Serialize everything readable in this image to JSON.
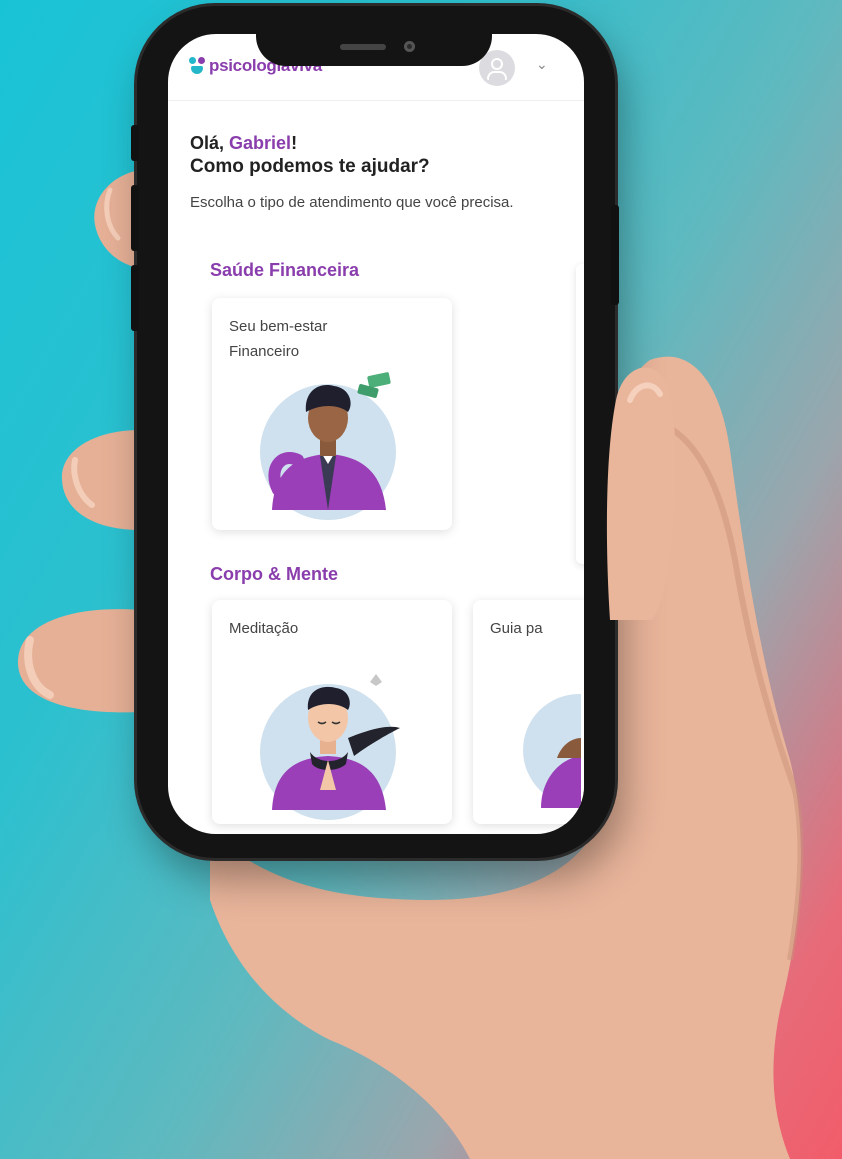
{
  "app": {
    "logo_text": "psicologiaviva",
    "brand_color": "#8a3dac"
  },
  "header": {
    "avatar_icon": "user-avatar-icon",
    "menu_icon": "chevron-down-icon"
  },
  "greeting": {
    "hello": "Olá,",
    "user_name": "Gabriel",
    "exclamation": "!",
    "question": "Como podemos te ajudar?",
    "subtitle": "Escolha o tipo de atendimento que você precisa."
  },
  "sections": [
    {
      "title": "Saúde Financeira",
      "cards": [
        {
          "title": "Seu bem-estar Financeiro",
          "illustration": "man-with-money-illustration"
        }
      ]
    },
    {
      "title": "Corpo & Mente",
      "cards": [
        {
          "title": "Meditação",
          "illustration": "man-meditating-illustration"
        },
        {
          "title": "Guia pa",
          "illustration": "person-illustration"
        }
      ]
    }
  ]
}
